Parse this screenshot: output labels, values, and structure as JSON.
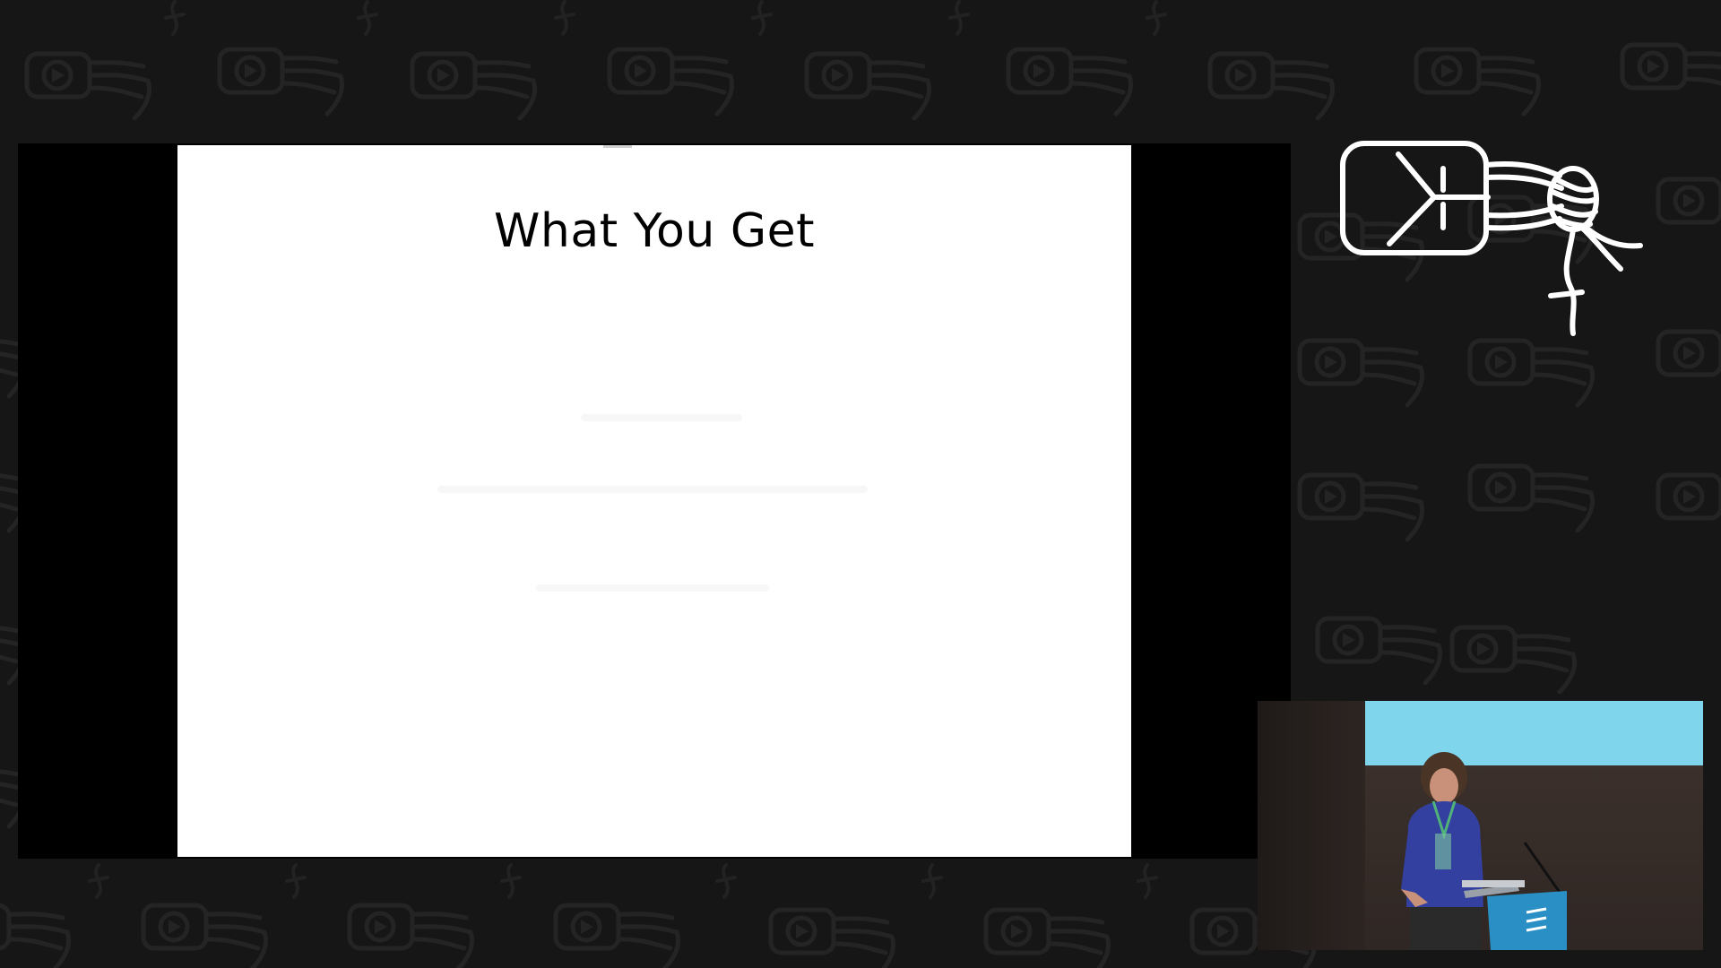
{
  "slide": {
    "title": "What You Get"
  },
  "colors": {
    "background": "#161616",
    "pattern": "#222222",
    "slide_bg": "#ffffff",
    "logo": "#ffffff",
    "camera_screen": "#7fd6ec",
    "speaker_shirt": "#3340a0",
    "lectern": "#2a8fc4"
  },
  "icons": {
    "logo": "conference-logo-icon",
    "background": "play-logo-pattern"
  }
}
